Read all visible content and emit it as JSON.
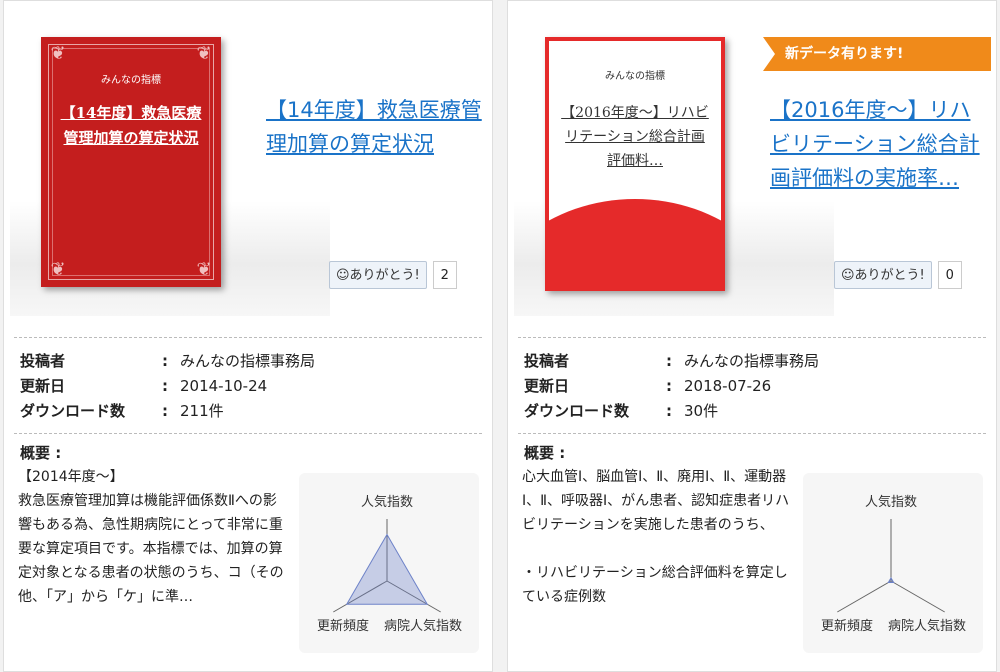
{
  "cards": [
    {
      "cover": {
        "publisher": "みんなの指標",
        "title": "【14年度】救急医療管理加算の算定状況"
      },
      "title": "【14年度】救急医療管理加算の算定状況",
      "thanks_label": "☺ありがとう!",
      "thanks_count": "2",
      "meta": {
        "poster_label": "投稿者",
        "poster_value": "みんなの指標事務局",
        "updated_label": "更新日",
        "updated_value": "2014-10-24",
        "downloads_label": "ダウンロード数",
        "downloads_value": "211件",
        "colon": ":"
      },
      "summary_label": "概要 :",
      "summary_text": "【2014年度～】\n救急医療管理加算は機能評価係数Ⅱへの影響もある為、急性期病院にとって非常に重要な算定項目です。本指標では、加算の算定対象となる患者の状態のうち、コ（その他、「ア」から「ケ」に準…",
      "radar": {
        "top": "人気指数",
        "left": "更新頻度",
        "right": "病院人気指数"
      },
      "radar_values": [
        0.75,
        0.75,
        0.75
      ]
    },
    {
      "ribbon": "新データ有ります!",
      "cover": {
        "publisher": "みんなの指標",
        "title": "【2016年度～】リハビリテーション総合計画評価料…"
      },
      "title": "【2016年度～】リハビリテーション総合計画評価料の実施率…",
      "thanks_label": "☺ありがとう!",
      "thanks_count": "0",
      "meta": {
        "poster_label": "投稿者",
        "poster_value": "みんなの指標事務局",
        "updated_label": "更新日",
        "updated_value": "2018-07-26",
        "downloads_label": "ダウンロード数",
        "downloads_value": "30件",
        "colon": ":"
      },
      "summary_label": "概要 :",
      "summary_text": "心大血管Ⅰ、脳血管Ⅰ、Ⅱ、廃用Ⅰ、Ⅱ、運動器Ⅰ、Ⅱ、呼吸器Ⅰ、がん患者、認知症患者リハビリテーションを実施した患者のうち、\n\n・リハビリテーション総合評価料を算定している症例数",
      "radar": {
        "top": "人気指数",
        "left": "更新頻度",
        "right": "病院人気指数"
      },
      "radar_values": [
        0.05,
        0.05,
        0.05
      ]
    }
  ]
}
